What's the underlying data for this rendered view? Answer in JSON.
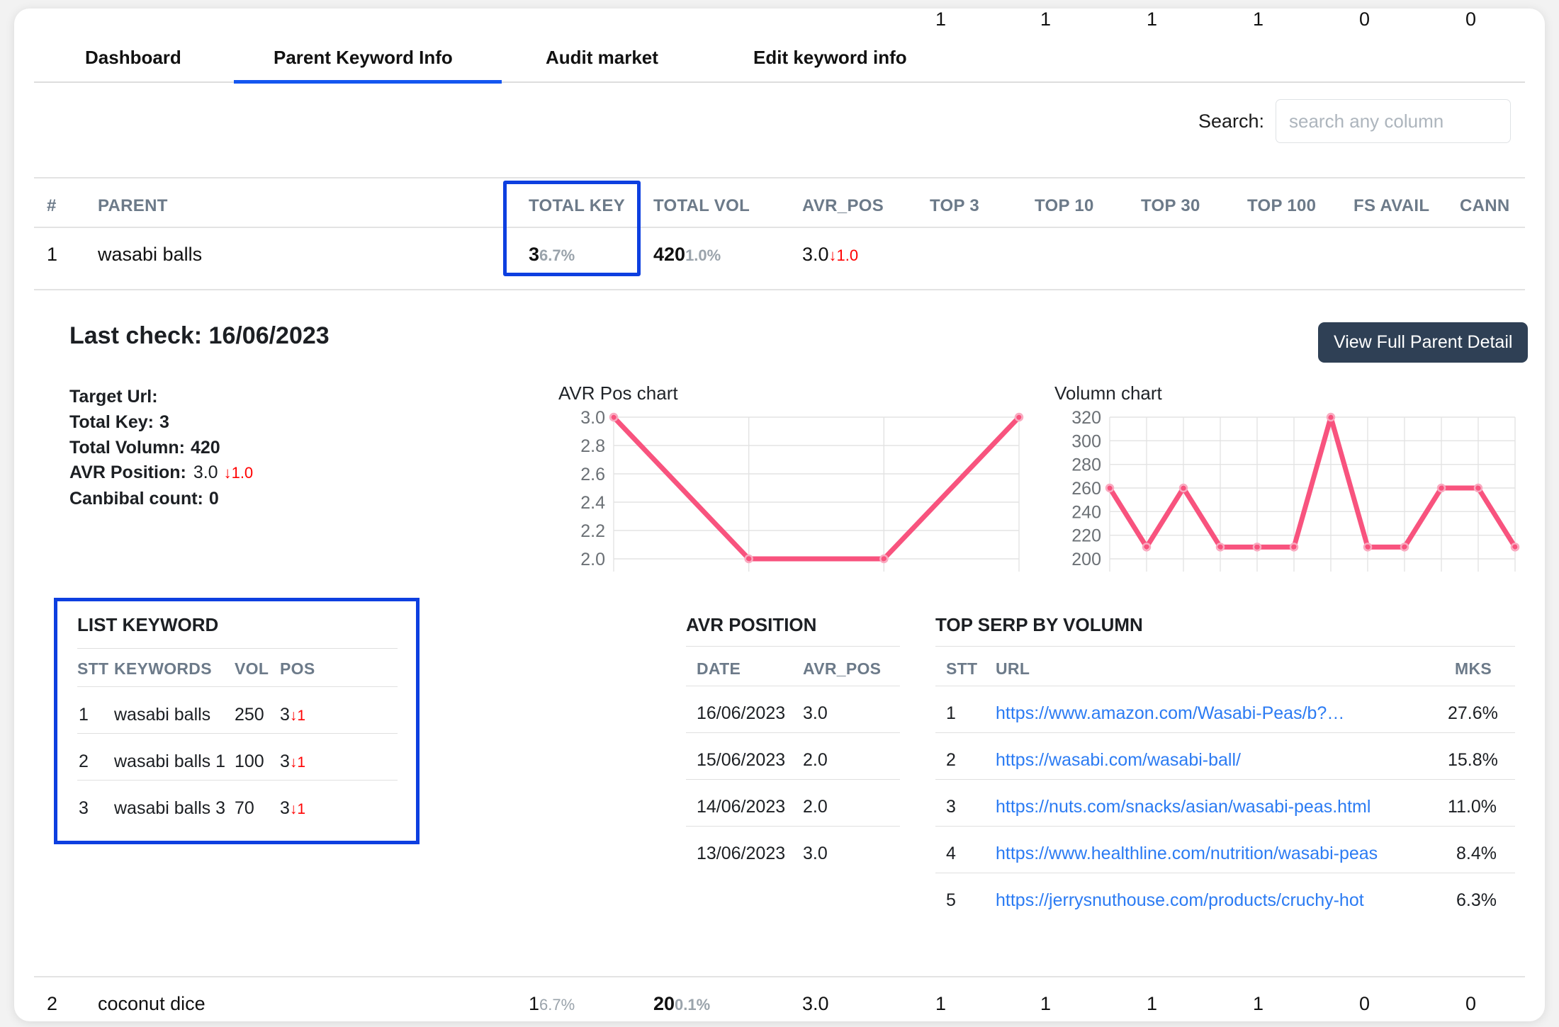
{
  "tabs": [
    {
      "label": "Dashboard",
      "active": false
    },
    {
      "label": "Parent Keyword Info",
      "active": true
    },
    {
      "label": "Audit market",
      "active": false
    },
    {
      "label": "Edit keyword info",
      "active": false
    }
  ],
  "search": {
    "label": "Search:",
    "placeholder": "search any column",
    "value": ""
  },
  "main_table": {
    "columns": [
      "#",
      "PARENT",
      "TOTAL KEY",
      "TOTAL VOL",
      "AVR_POS",
      "TOP 3",
      "TOP 10",
      "TOP 30",
      "TOP 100",
      "FS AVAIL",
      "CANN"
    ],
    "highlighted_column": "TOTAL KEY",
    "rows": [
      {
        "index": "1",
        "parent": "wasabi balls",
        "total_key": "3",
        "total_key_pct": "6.7%",
        "total_vol": "420",
        "total_vol_pct": "1.0%",
        "avr_pos": "3.0",
        "avr_pos_delta": "↓1.0",
        "top3": "1",
        "top10": "1",
        "top30": "1",
        "top100": "1",
        "fs_avail": "0",
        "cann": "0"
      },
      {
        "index": "2",
        "parent": "coconut dice",
        "total_key": "1",
        "total_key_pct": "6.7%",
        "total_vol": "20",
        "total_vol_pct": "0.1%",
        "avr_pos": "3.0",
        "avr_pos_delta": "",
        "top3": "1",
        "top10": "1",
        "top30": "1",
        "top100": "1",
        "fs_avail": "0",
        "cann": "0"
      }
    ]
  },
  "detail": {
    "last_check_label": "Last check: 16/06/2023",
    "view_full_button": "View Full Parent Detail",
    "fields": [
      {
        "label": "Target Url:",
        "value": ""
      },
      {
        "label": "Total Key:",
        "value": "3"
      },
      {
        "label": "Total Volumn:",
        "value": "420"
      },
      {
        "label": "AVR Position:",
        "value": "3.0",
        "delta": "↓1.0"
      },
      {
        "label": "Canbibal count:",
        "value": "0"
      }
    ]
  },
  "list_keyword": {
    "title": "LIST KEYWORD",
    "columns": [
      "STT",
      "KEYWORDS",
      "VOL",
      "POS"
    ],
    "rows": [
      {
        "stt": "1",
        "keyword": "wasabi balls",
        "vol": "250",
        "pos": "3",
        "delta": "↓1"
      },
      {
        "stt": "2",
        "keyword": "wasabi balls 1",
        "vol": "100",
        "pos": "3",
        "delta": "↓1"
      },
      {
        "stt": "3",
        "keyword": "wasabi balls 3",
        "vol": "70",
        "pos": "3",
        "delta": "↓1"
      }
    ]
  },
  "avr_position_table": {
    "title": "AVR POSITION",
    "columns": [
      "DATE",
      "AVR_POS"
    ],
    "rows": [
      {
        "date": "16/06/2023",
        "avr_pos": "3.0"
      },
      {
        "date": "15/06/2023",
        "avr_pos": "2.0"
      },
      {
        "date": "14/06/2023",
        "avr_pos": "2.0"
      },
      {
        "date": "13/06/2023",
        "avr_pos": "3.0"
      }
    ]
  },
  "top_serp": {
    "title": "TOP SERP BY VOLUMN",
    "columns": [
      "STT",
      "URL",
      "MKS"
    ],
    "rows": [
      {
        "stt": "1",
        "url": "https://www.amazon.com/Wasabi-Peas/b?…",
        "mks": "27.6%"
      },
      {
        "stt": "2",
        "url": "https://wasabi.com/wasabi-ball/",
        "mks": "15.8%"
      },
      {
        "stt": "3",
        "url": "https://nuts.com/snacks/asian/wasabi-peas.html",
        "mks": "11.0%"
      },
      {
        "stt": "4",
        "url": "https://www.healthline.com/nutrition/wasabi-peas",
        "mks": "8.4%"
      },
      {
        "stt": "5",
        "url": "https://jerrysnuthouse.com/products/cruchy-hot",
        "mks": "6.3%"
      }
    ]
  },
  "colors": {
    "accent_blue": "#1456f0",
    "highlight_box": "#0d3fe0",
    "chart_line": "#f8537e",
    "link": "#2b7bf3",
    "down_arrow": "#ff0000",
    "button_dark": "#2f4055",
    "header_text": "#6c7a89"
  },
  "chart_data": [
    {
      "type": "line",
      "title": "AVR Pos chart",
      "x": [
        1,
        2,
        3,
        4
      ],
      "values": [
        3.0,
        2.0,
        2.0,
        3.0
      ],
      "ylim": [
        2.0,
        3.0
      ],
      "yticks": [
        2.0,
        2.2,
        2.4,
        2.6,
        2.8,
        3.0
      ],
      "ytick_labels": [
        "2.0",
        "2.2",
        "2.4",
        "2.6",
        "2.8",
        "3.0"
      ],
      "xlabel": "",
      "ylabel": "",
      "grid": true,
      "legend": "none",
      "line_color": "#f8537e",
      "marker": "circle"
    },
    {
      "type": "line",
      "title": "Volumn chart",
      "x": [
        1,
        2,
        3,
        4,
        5,
        6,
        7,
        8,
        9,
        10,
        11,
        12
      ],
      "values": [
        260,
        210,
        260,
        210,
        210,
        210,
        320,
        210,
        210,
        260,
        260,
        210
      ],
      "ylim": [
        200,
        320
      ],
      "yticks": [
        200,
        220,
        240,
        260,
        280,
        300,
        320
      ],
      "ytick_labels": [
        "200",
        "220",
        "240",
        "260",
        "280",
        "300",
        "320"
      ],
      "xlabel": "",
      "ylabel": "",
      "grid": true,
      "legend": "none",
      "line_color": "#f8537e",
      "marker": "circle"
    }
  ]
}
